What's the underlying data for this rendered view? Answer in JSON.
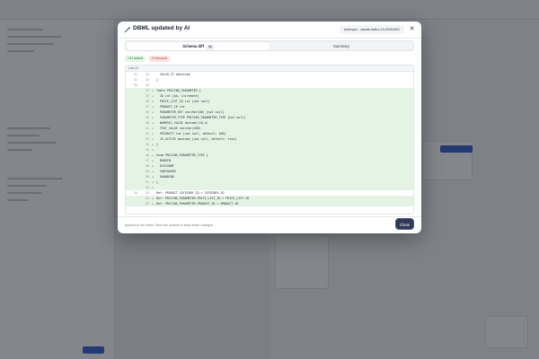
{
  "modal": {
    "title": "DBML updated by AI",
    "model_badge": "Anthropic - claude-haiku-4-5-20251001",
    "close_icon": "close-icon",
    "tabs": [
      {
        "label": "Schema diff",
        "count": "41",
        "active": true
      },
      {
        "label": "Summary",
        "active": false
      }
    ],
    "chips": {
      "added": "+41 added",
      "removed": "-0 removed"
    },
    "diff_header": "Line 31",
    "diff_lines": [
      {
        "old": "31",
        "new": "31",
        "mark": "",
        "text": "  VALID_TS datetime",
        "type": "ctx"
      },
      {
        "old": "32",
        "new": "32",
        "mark": "",
        "text": "}",
        "type": "ctx"
      },
      {
        "old": "33",
        "new": "33",
        "mark": "",
        "text": "",
        "type": "ctx"
      },
      {
        "old": "",
        "new": "34",
        "mark": "+",
        "text": "Table PRICING_PARAMETER {",
        "type": "add"
      },
      {
        "old": "",
        "new": "35",
        "mark": "+",
        "text": "  ID int [pk, increment]",
        "type": "add"
      },
      {
        "old": "",
        "new": "36",
        "mark": "+",
        "text": "  PRICE_LIST_ID int [not null]",
        "type": "add"
      },
      {
        "old": "",
        "new": "37",
        "mark": "+",
        "text": "  PRODUCT_ID int",
        "type": "add"
      },
      {
        "old": "",
        "new": "38",
        "mark": "+",
        "text": "  PARAMETER_KEY varchar(80) [not null]",
        "type": "add"
      },
      {
        "old": "",
        "new": "39",
        "mark": "+",
        "text": "  PARAMETER_TYPE PRICING_PARAMETER_TYPE [not null]",
        "type": "add"
      },
      {
        "old": "",
        "new": "40",
        "mark": "+",
        "text": "  NUMERIC_VALUE decimal(18,4)",
        "type": "add"
      },
      {
        "old": "",
        "new": "41",
        "mark": "+",
        "text": "  TEXT_VALUE varchar(400)",
        "type": "add"
      },
      {
        "old": "",
        "new": "42",
        "mark": "+",
        "text": "  PRIORITY int [not null, default: 100]",
        "type": "add"
      },
      {
        "old": "",
        "new": "43",
        "mark": "+",
        "text": "  IS_ACTIVE boolean [not null, default: true]",
        "type": "add"
      },
      {
        "old": "",
        "new": "44",
        "mark": "+",
        "text": "}",
        "type": "add"
      },
      {
        "old": "",
        "new": "45",
        "mark": "+",
        "text": "",
        "type": "add"
      },
      {
        "old": "",
        "new": "46",
        "mark": "+",
        "text": "Enum PRICING_PARAMETER_TYPE {",
        "type": "add"
      },
      {
        "old": "",
        "new": "47",
        "mark": "+",
        "text": "  MARGIN",
        "type": "add"
      },
      {
        "old": "",
        "new": "48",
        "mark": "+",
        "text": "  DISCOUNT",
        "type": "add"
      },
      {
        "old": "",
        "new": "49",
        "mark": "+",
        "text": "  SURCHARGE",
        "type": "add"
      },
      {
        "old": "",
        "new": "50",
        "mark": "+",
        "text": "  ROUNDING",
        "type": "add"
      },
      {
        "old": "",
        "new": "51",
        "mark": "+",
        "text": "}",
        "type": "add"
      },
      {
        "old": "",
        "new": "52",
        "mark": "+",
        "text": "",
        "type": "add"
      },
      {
        "old": "34",
        "new": "53",
        "mark": "",
        "text": "Ref: PRODUCT.CATEGORY_ID > CATEGORY.ID",
        "type": "ctx"
      },
      {
        "old": "",
        "new": "54",
        "mark": "+",
        "text": "Ref: PRICING_PARAMETER.PRICE_LIST_ID > PRICE_LIST.ID",
        "type": "add"
      },
      {
        "old": "",
        "new": "55",
        "mark": "+",
        "text": "Ref: PRICING_PARAMETER.PRODUCT_ID > PRODUCT.ID",
        "type": "add"
      }
    ],
    "footer_note": "Applied to the editor. Save the module to keep these changes.",
    "close_button": "Close"
  },
  "colors": {
    "added_bg": "#e3f4e4",
    "added_text": "#2b7a33",
    "removed_text": "#b53434",
    "primary_button": "#2f3a55"
  }
}
